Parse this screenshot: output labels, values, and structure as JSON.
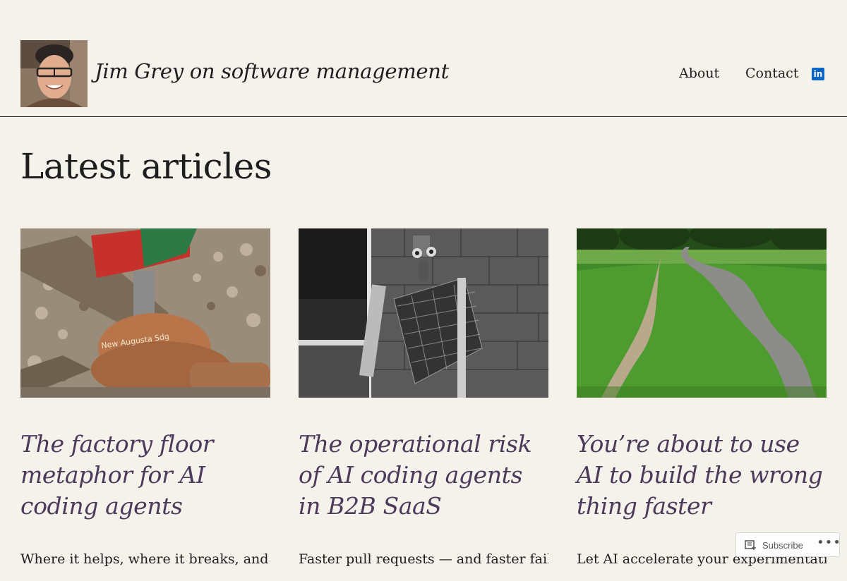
{
  "header": {
    "site_title": "Jim Grey on software management",
    "nav": {
      "about": "About",
      "contact": "Contact"
    },
    "linkedin_icon": "linkedin-icon",
    "linkedin_glyph": "in"
  },
  "main": {
    "heading": "Latest articles",
    "articles": [
      {
        "title": "The factory floor metaphor for AI coding agents",
        "excerpt": "Where it helps, where it breaks, and",
        "image": "rusty-railroad-switch-with-flag"
      },
      {
        "title": "The operational risk of AI coding agents in B2B SaaS",
        "excerpt": "Faster pull requests — and faster failure.",
        "image": "metal-robot-sculpture-bw"
      },
      {
        "title": "You’re about to use AI to build the wrong thing faster",
        "excerpt": "Let AI accelerate your experimentation.",
        "image": "park-paths-diverging"
      }
    ]
  },
  "subscribe_bar": {
    "subscribe_label": "Subscribe",
    "more_label": "•••",
    "subscribe_icon": "reader-icon",
    "more_icon": "ellipsis-icon"
  },
  "colors": {
    "background": "#f5f2ec",
    "article_title": "#4b3a5a",
    "text": "#1e1e1e",
    "linkedin": "#0a66c2"
  }
}
